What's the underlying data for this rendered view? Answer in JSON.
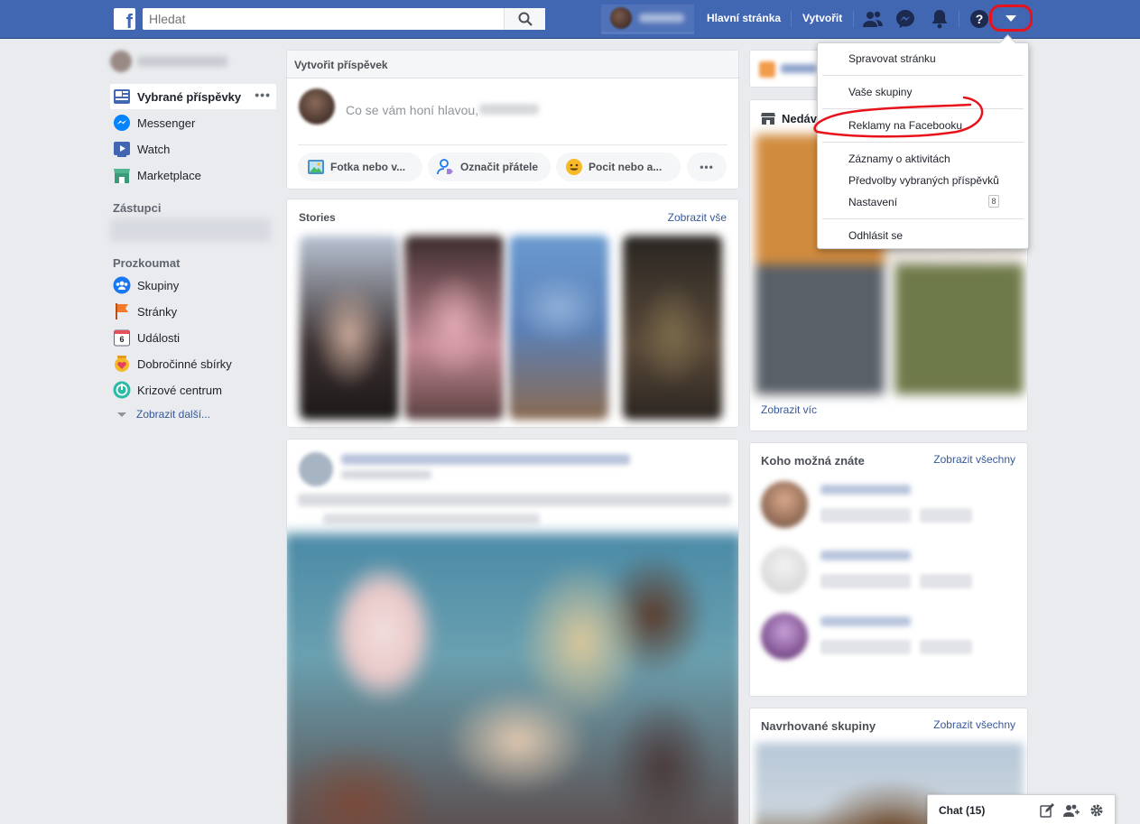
{
  "topbar": {
    "logo": "f",
    "search_placeholder": "Hledat",
    "nav": {
      "home": "Hlavní stránka",
      "create": "Vytvořit"
    },
    "icons": [
      "friends-icon",
      "messenger-icon",
      "bell-icon",
      "help-icon",
      "dropdown-arrow-icon"
    ],
    "help_glyph": "?"
  },
  "sidebar": {
    "items": [
      {
        "label": "Vybrané příspěvky",
        "icon": "news-feed-icon",
        "active": true
      },
      {
        "label": "Messenger",
        "icon": "messenger-icon"
      },
      {
        "label": "Watch",
        "icon": "watch-icon"
      },
      {
        "label": "Marketplace",
        "icon": "marketplace-icon"
      }
    ],
    "dots": "•••",
    "section_shortcuts": "Zástupci",
    "section_explore": "Prozkoumat",
    "explore_items": [
      {
        "label": "Skupiny",
        "icon": "groups-icon"
      },
      {
        "label": "Stránky",
        "icon": "pages-flag-icon"
      },
      {
        "label": "Události",
        "icon": "calendar-icon",
        "badge": "6"
      },
      {
        "label": "Dobročinné sbírky",
        "icon": "fundraiser-icon"
      },
      {
        "label": "Krizové centrum",
        "icon": "crisis-icon"
      }
    ],
    "show_more": "Zobrazit další..."
  },
  "composer": {
    "header": "Vytvořit příspěvek",
    "prompt": "Co se vám honí hlavou,",
    "actions": [
      {
        "label": "Fotka nebo v...",
        "icon": "photo-icon"
      },
      {
        "label": "Označit přátele",
        "icon": "tag-friends-icon"
      },
      {
        "label": "Pocit nebo a...",
        "icon": "feeling-icon"
      }
    ],
    "more": "•••"
  },
  "stories": {
    "title": "Stories",
    "see_all": "Zobrazit vše"
  },
  "right": {
    "recent_title": "Nedáv",
    "recent_more": "Zobrazit víc",
    "people_title": "Koho možná znáte",
    "people_link": "Zobrazit všechny",
    "groups_title": "Navrhované skupiny",
    "groups_link": "Zobrazit všechny"
  },
  "menu": {
    "items": [
      "Spravovat stránku",
      "Vaše skupiny",
      "Reklamy na Facebooku",
      "Záznamy o aktivitách",
      "Předvolby vybraných příspěvků",
      "Nastavení",
      "Odhlásit se"
    ],
    "activity_badge": "8"
  },
  "chat": {
    "label": "Chat (15)"
  },
  "colors": {
    "brand": "#4267b2",
    "link": "#365899",
    "annotation": "#e8121a"
  }
}
